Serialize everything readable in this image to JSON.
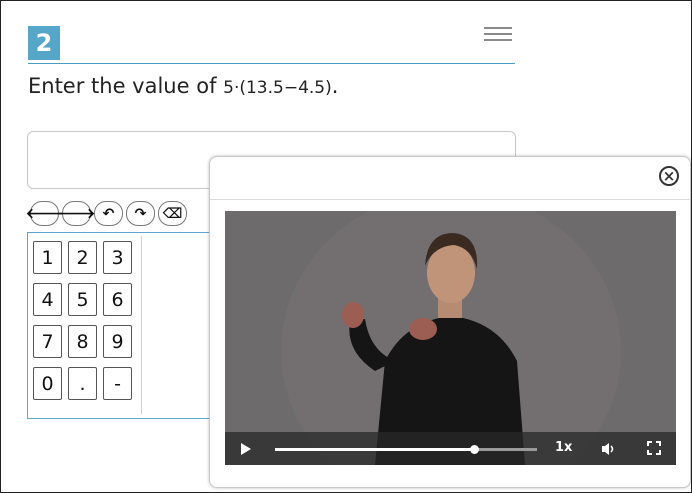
{
  "question": {
    "number": "2",
    "prompt_prefix": "Enter the value of ",
    "expression": "5·(13.5−4.5)",
    "prompt_suffix": "."
  },
  "answer": {
    "value": ""
  },
  "toolbar": {
    "buttons": [
      {
        "icon": "arrow-left-icon",
        "glyph": "🡐"
      },
      {
        "icon": "arrow-right-icon",
        "glyph": "🡒"
      },
      {
        "icon": "undo-icon",
        "glyph": "↶"
      },
      {
        "icon": "redo-icon",
        "glyph": "↷"
      },
      {
        "icon": "backspace-icon",
        "glyph": "⌫"
      }
    ]
  },
  "keypad": {
    "keys": [
      "1",
      "2",
      "3",
      "4",
      "5",
      "6",
      "7",
      "8",
      "9",
      "0",
      ".",
      "-"
    ]
  },
  "video_player": {
    "speed": "1x",
    "progress": 0.76
  }
}
